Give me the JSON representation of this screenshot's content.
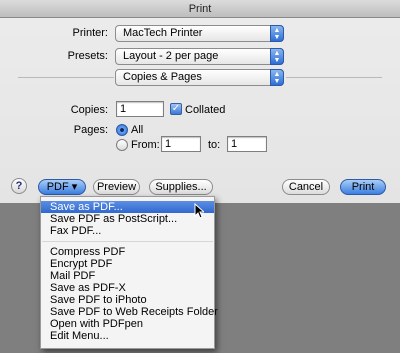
{
  "window": {
    "title": "Print"
  },
  "printer": {
    "label": "Printer:",
    "value": "MacTech Printer"
  },
  "presets": {
    "label": "Presets:",
    "value": "Layout - 2 per page"
  },
  "panel": {
    "value": "Copies & Pages"
  },
  "copies": {
    "label": "Copies:",
    "value": "1",
    "collated_label": "Collated",
    "collated_checked": true
  },
  "pages": {
    "label": "Pages:",
    "all_label": "All",
    "from_label": "From:",
    "from_value": "1",
    "to_label": "to:",
    "to_value": "1"
  },
  "buttons": {
    "help": "?",
    "pdf": "PDF ▾",
    "preview": "Preview",
    "supplies": "Supplies...",
    "cancel": "Cancel",
    "print": "Print"
  },
  "pdf_menu": {
    "group1": [
      "Save as PDF...",
      "Save PDF as PostScript...",
      "Fax PDF..."
    ],
    "group2": [
      "Compress PDF",
      "Encrypt PDF",
      "Mail PDF",
      "Save as PDF-X",
      "Save PDF to iPhoto",
      "Save PDF to Web Receipts Folder",
      "Open with PDFpen",
      "Edit Menu..."
    ],
    "selected_index": 0
  },
  "colors": {
    "accent": "#2f68cf",
    "sheet": "#e8e8e8",
    "dimmed": "#7f7f7f"
  }
}
